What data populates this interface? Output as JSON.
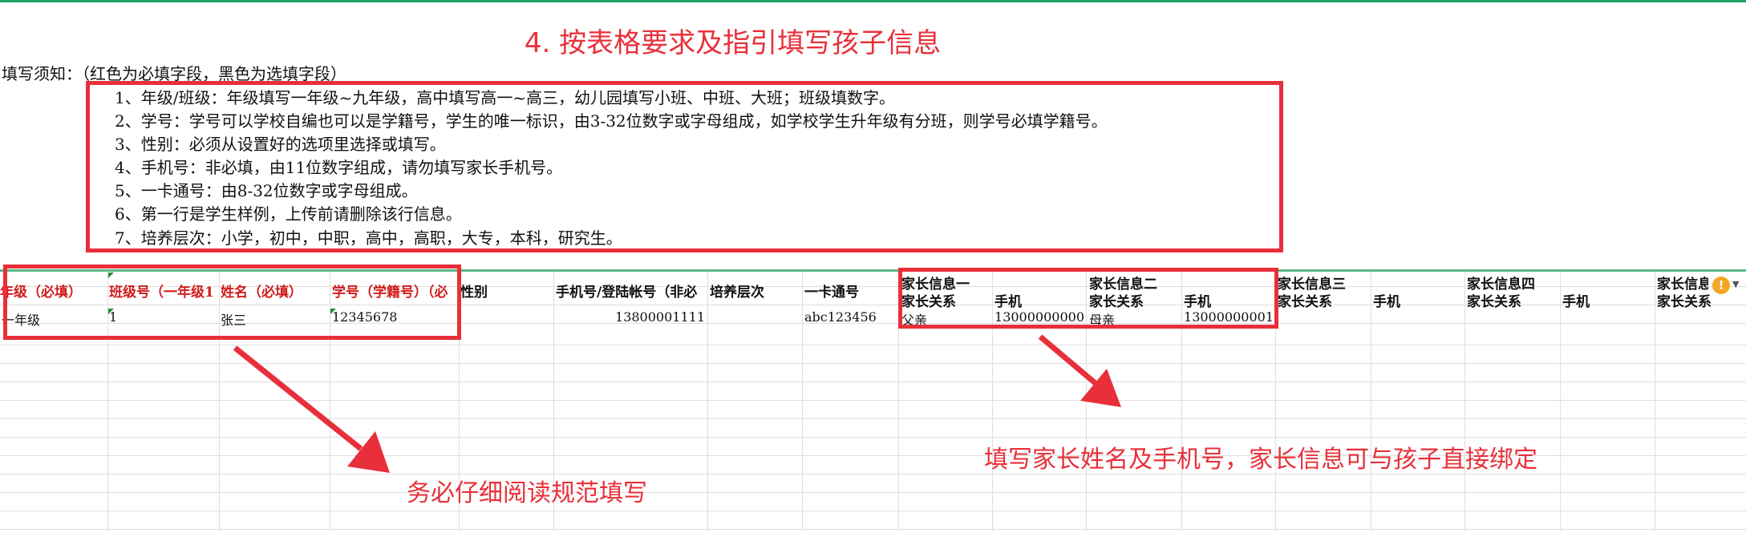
{
  "heading": "4. 按表格要求及指引填写孩子信息",
  "instructions": {
    "title": "填写须知：（红色为必填字段，黑色为选填字段）",
    "lines": [
      "1、年级/班级：年级填写一年级~九年级，高中填写高一~高三，幼儿园填写小班、中班、大班；班级填数字。",
      "2、学号：学号可以学校自编也可以是学籍号，学生的唯一标识，由3-32位数字或字母组成，如学校学生升年级有分班，则学号必填学籍号。",
      "3、性别：必须从设置好的选项里选择或填写。",
      "4、手机号：非必填，由11位数字组成，请勿填写家长手机号。",
      "5、一卡通号：由8-32位数字或字母组成。",
      "6、第一行是学生样例，上传前请删除该行信息。",
      "7、培养层次：小学，初中，中职，高中，高职，大专，本科，研究生。"
    ]
  },
  "table": {
    "headers": {
      "grade": "年级（必填）",
      "class_no": "班级号（一年级1",
      "name": "姓名（必填）",
      "student_id": "学号（学籍号）（必",
      "gender": "性别",
      "phone_account": "手机号/登陆帐号（非必",
      "level": "培养层次",
      "card_no": "一卡通号",
      "parent1": "家长信息一",
      "parent2": "家长信息二",
      "parent3": "家长信息三",
      "parent4": "家长信息四",
      "parent5": "家长信息",
      "relation": "家长关系",
      "mobile": "手机",
      "relation5": "家长关系"
    },
    "sample_row": {
      "grade": "一年级",
      "class_no": "1",
      "name": "张三",
      "student_id": "12345678",
      "phone_account": "13800001111",
      "card_no": "abc123456",
      "p1_relation": "父亲",
      "p1_mobile": "13000000000",
      "p2_relation": "母亲",
      "p2_mobile": "13000000001"
    }
  },
  "warning_icon": "exclamation-warning-icon",
  "annotations": {
    "left": "务必仔细阅读规范填写",
    "right": "填写家长姓名及手机号，家长信息可与孩子直接绑定"
  },
  "colors": {
    "accent_red": "#e8303a",
    "required_header": "#d01c1c",
    "sheet_green": "#21a366"
  }
}
